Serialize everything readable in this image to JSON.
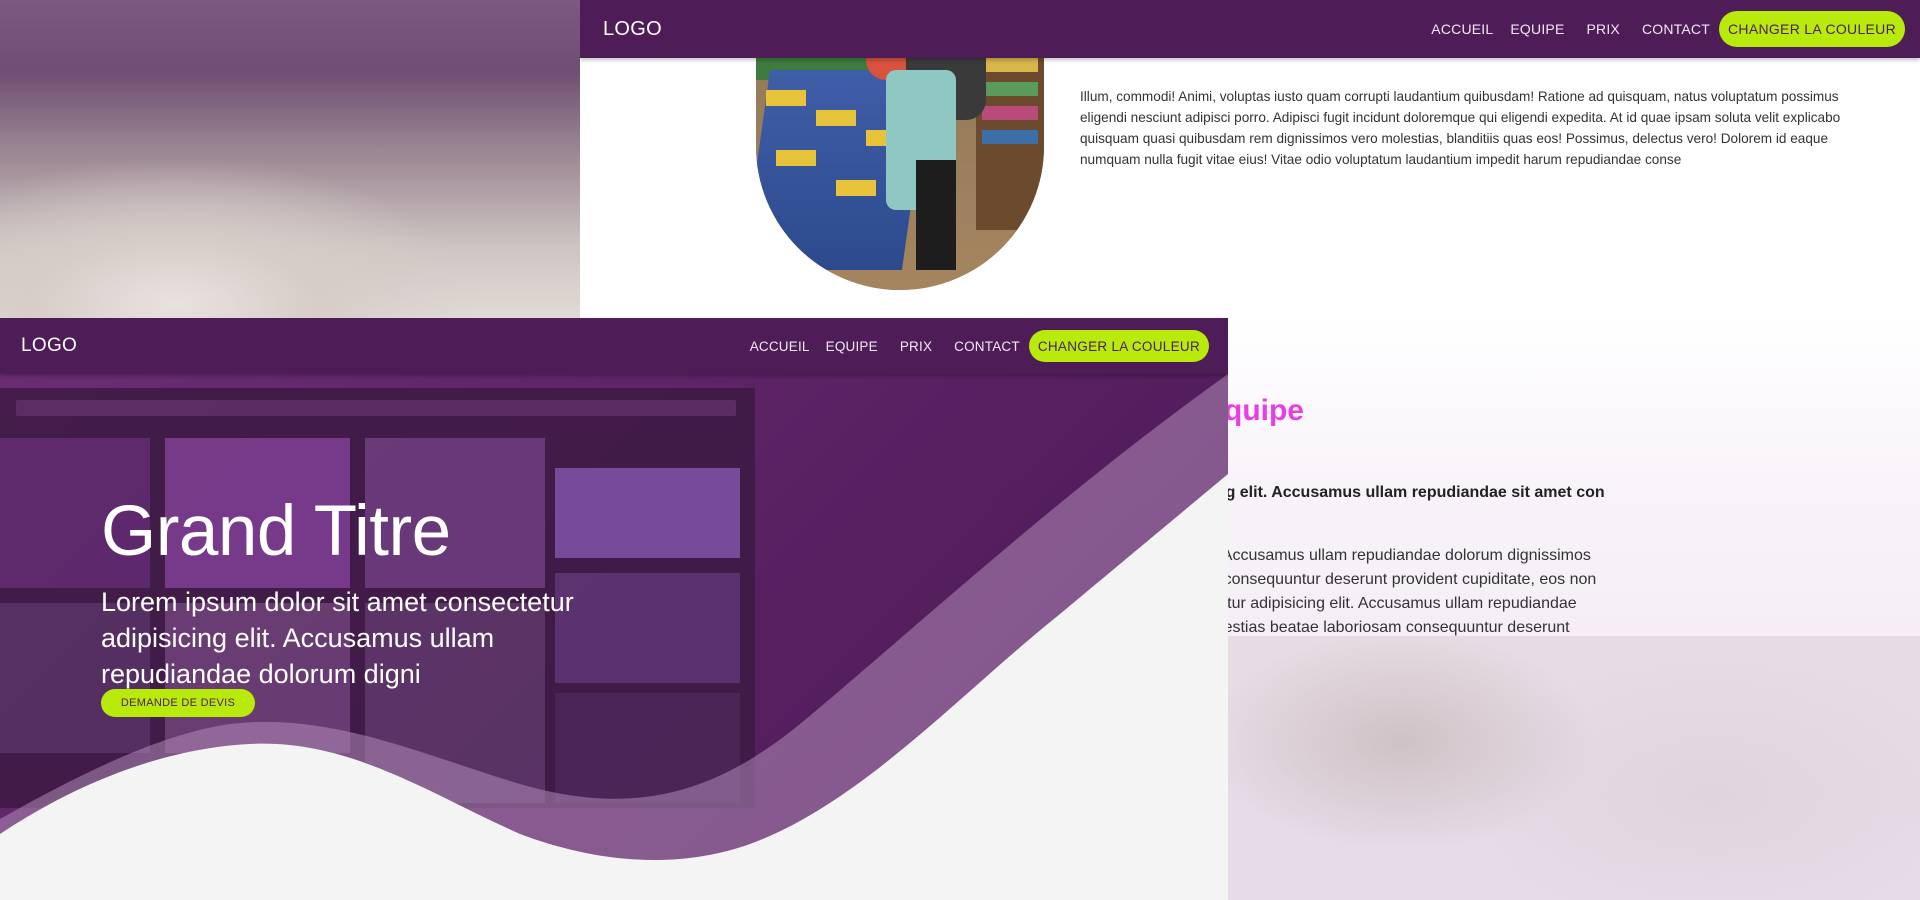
{
  "top_window": {
    "nav": {
      "logo": "LOGO",
      "links": [
        "ACCUEIL",
        "EQUIPE",
        "PRIX",
        "CONTACT"
      ],
      "cta": "CHANGER LA COULEUR"
    },
    "paragraph": "Illum, commodi! Animi, voluptas iusto quam corrupti laudantium quibusdam! Ratione ad quisquam, natus voluptatum possimus eligendi nesciunt adipisci porro. Adipisci fugit incidunt doloremque qui eligendi expedita. At id quae ipsam soluta velit explicabo quisquam quasi quibusdam rem dignissimos vero molestias, blanditiis quas eos! Possimus, delectus vero! Dolorem id eaque numquam nulla fugit vitae eius! Vitae odio voluptatum laudantium impedit harum repudiandae conse"
  },
  "equipe_section": {
    "title_fragment": "quipe",
    "lead_fragment": "icing elit. Accusamus ullam repudiandae sit amet con",
    "paragraph_lines": [
      "g elit. Accusamus ullam repudiandae dolorum dignissimos",
      "osam consequuntur deserunt provident cupiditate, eos non",
      "nsectetur adipisicing elit. Accusamus ullam repudiandae",
      "d. Molestias beatae laboriosam consequuntur deserunt"
    ]
  },
  "front_window": {
    "nav": {
      "logo": "LOGO",
      "links": [
        "ACCUEIL",
        "EQUIPE",
        "PRIX",
        "CONTACT"
      ],
      "cta": "CHANGER LA COULEUR"
    },
    "hero": {
      "title": "Grand Titre",
      "subtitle": "Lorem ipsum dolor sit amet consectetur adipisicing elit. Accusamus ullam repudiandae dolorum digni",
      "button": "DEMANDE DE DEVIS"
    }
  },
  "colors": {
    "nav_bg": "#4e1d57",
    "accent_green": "#b8ea0c",
    "accent_pink": "#e83ee4",
    "hero_purple": "#5a2163"
  }
}
